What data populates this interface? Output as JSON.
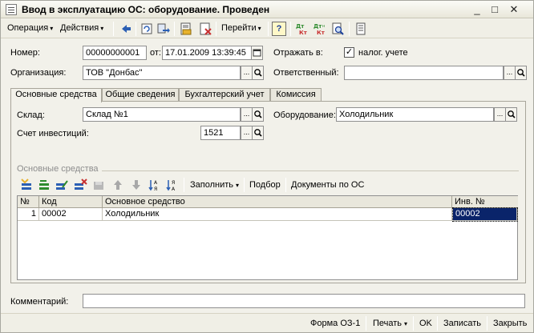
{
  "window": {
    "title": "Ввод в эксплуатацию ОС: оборудование. Проведен",
    "minimize": "_",
    "maximize": "□",
    "close": "✕"
  },
  "toolbar": {
    "operation_label": "Операция",
    "actions_label": "Действия",
    "goto_label": "Перейти",
    "help_label": "?",
    "dropdown_arrow": "▾",
    "icons": [
      "prev-icon",
      "refresh-icon",
      "navigate-icon",
      "post-document-icon",
      "unpost-document-icon",
      "dt-kt-icon",
      "dt-kt-movements-icon",
      "search-preview-icon",
      "structure-icon"
    ]
  },
  "header": {
    "number_label": "Номер:",
    "number_value": "00000000001",
    "date_label": "от:",
    "date_value": "17.01.2009 13:39:45",
    "reflect_label": "Отражать в:",
    "tax_accounting_label": "налог. учете",
    "tax_accounting_checked": true,
    "organization_label": "Организация:",
    "organization_value": "ТОВ \"Донбас\"",
    "responsible_label": "Ответственный:",
    "responsible_value": "",
    "ellipsis": "...",
    "search": "🔍"
  },
  "tabs": [
    {
      "label": "Основные средства",
      "active": true
    },
    {
      "label": "Общие сведения",
      "active": false
    },
    {
      "label": "Бухгалтерский учет",
      "active": false
    },
    {
      "label": "Комиссия",
      "active": false
    }
  ],
  "main_tab": {
    "warehouse_label": "Склад:",
    "warehouse_value": "Склад №1",
    "equipment_label": "Оборудование:",
    "equipment_value": "Холодильник",
    "investment_account_label": "Счет инвестиций:",
    "investment_account_value": "1521",
    "section_title": "Основные средства",
    "fill_label": "Заполнить",
    "selection_label": "Подбор",
    "docs_label": "Документы по ОС"
  },
  "table": {
    "columns": [
      "№",
      "Код",
      "Основное средство",
      "Инв. №"
    ],
    "rows": [
      {
        "num": "1",
        "code": "00002",
        "asset": "Холодильник",
        "inv": "00002"
      }
    ]
  },
  "footer": {
    "comment_label": "Комментарий:",
    "comment_value": "",
    "form_label": "Форма ОЗ-1",
    "print_label": "Печать",
    "ok_label": "OK",
    "save_label": "Записать",
    "close_label": "Закрыть"
  },
  "colors": {
    "selected_cell": "#0a246a",
    "window_bg": "#f2f1ea",
    "icon_blue": "#2b5fb4",
    "icon_green": "#2e8b2e",
    "icon_red": "#c83030"
  }
}
